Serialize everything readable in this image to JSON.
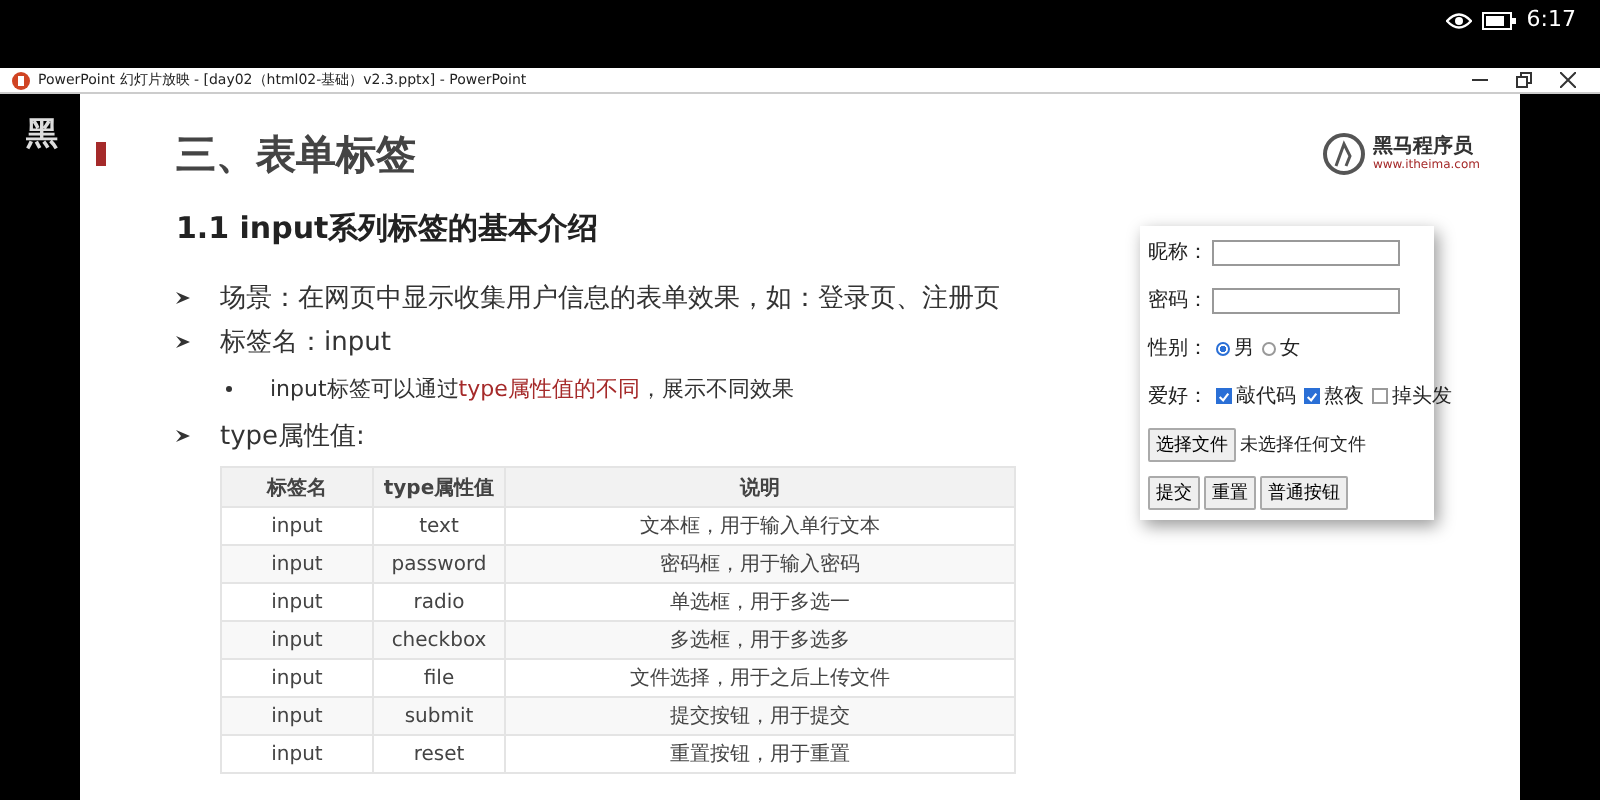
{
  "status_bar": {
    "time": "6:17"
  },
  "window": {
    "title": "PowerPoint 幻灯片放映 - [day02（html02-基础）v2.3.pptx] - PowerPoint"
  },
  "backdrop_text": "黑",
  "slide": {
    "title": "三、表单标签",
    "logo": {
      "name": "黑马程序员",
      "url": "www.itheima.com"
    },
    "heading": "1.1 input系列标签的基本介绍",
    "bullets": [
      {
        "kind": "main",
        "parts": [
          {
            "text": "场景：在网页中显示收集用户信息的表单效果，如：登录页、注册页",
            "highlight": false
          }
        ]
      },
      {
        "kind": "main",
        "parts": [
          {
            "text": "标签名：input",
            "highlight": false
          }
        ]
      },
      {
        "kind": "sub",
        "parts": [
          {
            "text": "input标签可以通过",
            "highlight": false
          },
          {
            "text": "type属性值的不同",
            "highlight": true
          },
          {
            "text": "，展示不同效果",
            "highlight": false
          }
        ]
      },
      {
        "kind": "main",
        "parts": [
          {
            "text": "type属性值:",
            "highlight": false
          }
        ]
      }
    ],
    "table": {
      "columns": [
        "标签名",
        "type属性值",
        "说明"
      ],
      "rows": [
        [
          "input",
          "text",
          "文本框，用于输入单行文本"
        ],
        [
          "input",
          "password",
          "密码框，用于输入密码"
        ],
        [
          "input",
          "radio",
          "单选框，用于多选一"
        ],
        [
          "input",
          "checkbox",
          "多选框，用于多选多"
        ],
        [
          "input",
          "file",
          "文件选择，用于之后上传文件"
        ],
        [
          "input",
          "submit",
          "提交按钮，用于提交"
        ],
        [
          "input",
          "reset",
          "重置按钮，用于重置"
        ]
      ]
    },
    "form": {
      "rows": [
        {
          "kind": "text",
          "label": "昵称："
        },
        {
          "kind": "text",
          "label": "密码："
        },
        {
          "kind": "radio",
          "label": "性别：",
          "options": [
            {
              "label": "男",
              "selected": true
            },
            {
              "label": "女",
              "selected": false
            }
          ]
        },
        {
          "kind": "checkbox",
          "label": "爱好：",
          "options": [
            {
              "label": "敲代码",
              "checked": true
            },
            {
              "label": "熬夜",
              "checked": true
            },
            {
              "label": "掉头发",
              "checked": false
            }
          ]
        },
        {
          "kind": "file",
          "button": "选择文件",
          "status": "未选择任何文件"
        },
        {
          "kind": "buttons",
          "buttons": [
            "提交",
            "重置",
            "普通按钮"
          ]
        }
      ]
    }
  }
}
